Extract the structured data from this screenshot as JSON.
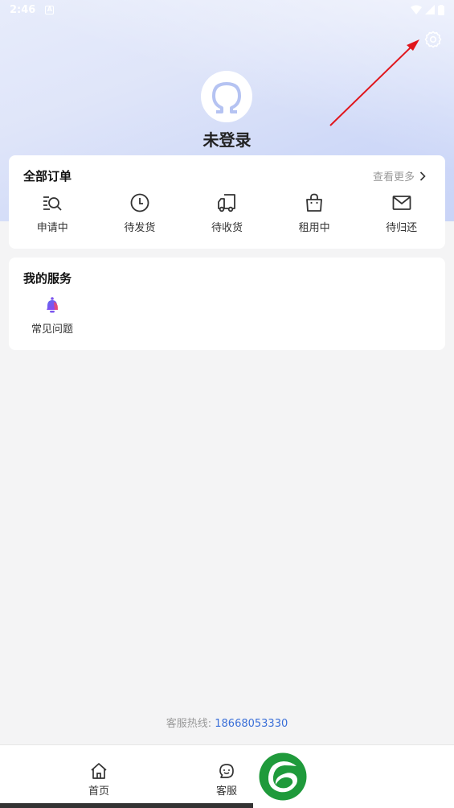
{
  "status_bar": {
    "time": "2:46",
    "notification_icon": "A"
  },
  "header": {
    "settings_icon": "gear-icon",
    "username": "未登录"
  },
  "orders": {
    "title": "全部订单",
    "more_label": "查看更多",
    "items": [
      {
        "label": "申请中",
        "icon": "list-search-icon"
      },
      {
        "label": "待发货",
        "icon": "clock-icon"
      },
      {
        "label": "待收货",
        "icon": "truck-icon"
      },
      {
        "label": "租用中",
        "icon": "bag-icon"
      },
      {
        "label": "待归还",
        "icon": "mail-icon"
      }
    ]
  },
  "services": {
    "title": "我的服务",
    "items": [
      {
        "label": "常见问题",
        "icon": "bell-icon"
      }
    ]
  },
  "hotline": {
    "label": "客服热线:",
    "number": "18668053330"
  },
  "tabbar": {
    "items": [
      {
        "label": "首页",
        "icon": "home-icon"
      },
      {
        "label": "客服",
        "icon": "support-icon"
      }
    ]
  },
  "colors": {
    "accent": "#3a6fd8",
    "brand_green": "#1f9a3b",
    "annotation_arrow": "#e0161c"
  }
}
